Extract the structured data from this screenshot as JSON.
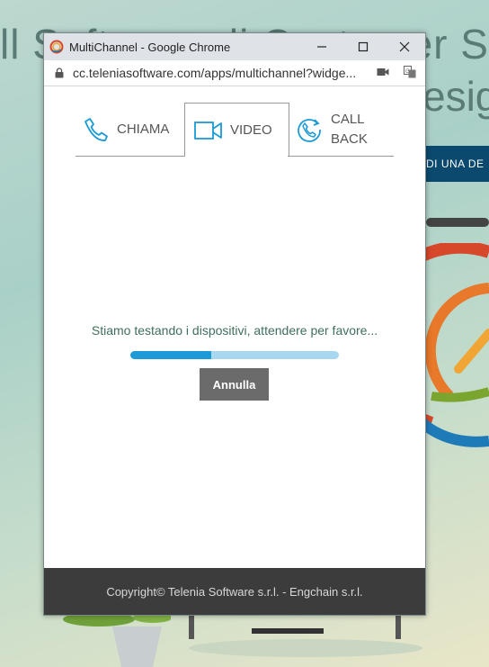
{
  "background": {
    "headline_line1": "ll Software di Customer Se",
    "headline_line2": "esig",
    "banner_text": "DI UNA DE"
  },
  "window": {
    "title": "MultiChannel - Google Chrome",
    "url": "cc.teleniasoftware.com/apps/multichannel?widge..."
  },
  "tabs": [
    {
      "label": "CHIAMA",
      "active": false
    },
    {
      "label": "VIDEO",
      "active": true
    },
    {
      "label": "CALL BACK",
      "active": false
    }
  ],
  "status_text": "Stiamo testando i dispositivi, attendere per favore...",
  "progress": {
    "percent": 39,
    "fill_color": "#1b9ad6",
    "track_color": "#a8d8ef"
  },
  "cancel_label": "Annulla",
  "footer_text": "Copyright© Telenia Software s.r.l. - Engchain s.r.l.",
  "colors": {
    "accent": "#1b9ad6",
    "status_text": "#3f6f5a",
    "footer_bg": "#3c3c3c",
    "banner_bg": "#0b4a6e"
  }
}
